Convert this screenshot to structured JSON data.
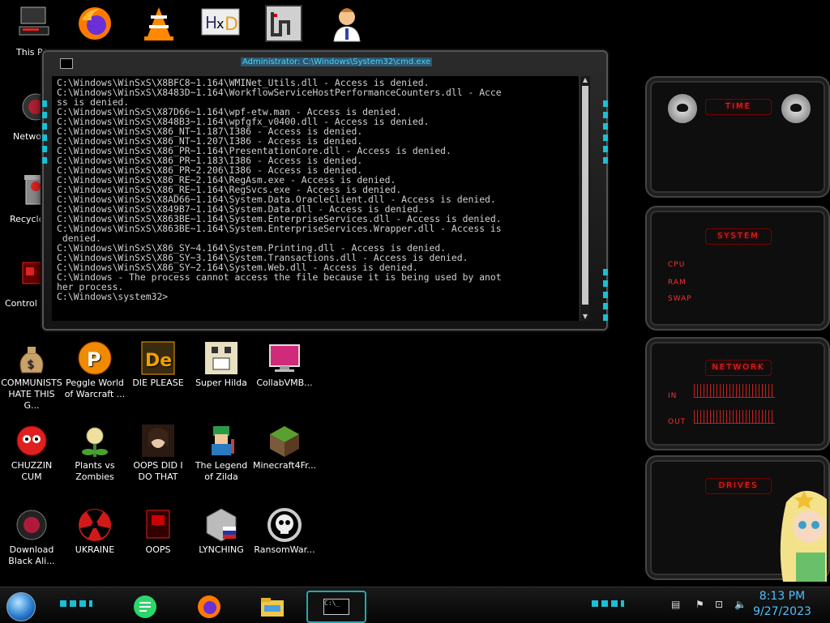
{
  "desktop": {
    "left_icons": [
      {
        "label": "This PC"
      },
      {
        "label": "Netwo"
      },
      {
        "label": "Recycle"
      },
      {
        "label": "Control"
      }
    ],
    "icons": [
      {
        "label": "COMMUNISTS HATE THIS G..."
      },
      {
        "label": "Peggle World of Warcraft ..."
      },
      {
        "label": "DIE PLEASE"
      },
      {
        "label": "Super Hilda"
      },
      {
        "label": "CollabVMB..."
      },
      {
        "label": "CHUZZIN CUM"
      },
      {
        "label": "Plants vs Zombies"
      },
      {
        "label": "OOPS DID I DO THAT"
      },
      {
        "label": "The Legend of Zilda"
      },
      {
        "label": "Minecraft4Fr..."
      },
      {
        "label": "Download Black Ali..."
      },
      {
        "label": "UKRAINE"
      },
      {
        "label": "OOPS"
      },
      {
        "label": "LYNCHING"
      },
      {
        "label": "RansomWar..."
      }
    ]
  },
  "console": {
    "title": "Administrator: C:\\Windows\\System32\\cmd.exe",
    "lines": [
      "C:\\Windows\\WinSxS\\X8BFC8~1.164\\WMINet_Utils.dll - Access is denied.",
      "C:\\Windows\\WinSxS\\X8483D~1.164\\WorkflowServiceHostPerformanceCounters.dll - Acce",
      "ss is denied.",
      "C:\\Windows\\WinSxS\\X87D66~1.164\\wpf-etw.man - Access is denied.",
      "C:\\Windows\\WinSxS\\X848B3~1.164\\wpfgfx_v0400.dll - Access is denied.",
      "C:\\Windows\\WinSxS\\X86_NT~1.187\\I386 - Access is denied.",
      "C:\\Windows\\WinSxS\\X86_NT~1.207\\I386 - Access is denied.",
      "C:\\Windows\\WinSxS\\X86_PR~1.164\\PresentationCore.dll - Access is denied.",
      "C:\\Windows\\WinSxS\\X86_PR~1.183\\I386 - Access is denied.",
      "C:\\Windows\\WinSxS\\X86_PR~2.206\\I386 - Access is denied.",
      "C:\\Windows\\WinSxS\\X86_RE~2.164\\RegAsm.exe - Access is denied.",
      "C:\\Windows\\WinSxS\\X86_RE~1.164\\RegSvcs.exe - Access is denied.",
      "C:\\Windows\\WinSxS\\X8AD66~1.164\\System.Data.OracleClient.dll - Access is denied.",
      "C:\\Windows\\WinSxS\\X849B7~1.164\\System.Data.dll - Access is denied.",
      "C:\\Windows\\WinSxS\\X863BE~1.164\\System.EnterpriseServices.dll - Access is denied.",
      "",
      "C:\\Windows\\WinSxS\\X863BE~1.164\\System.EnterpriseServices.Wrapper.dll - Access is",
      " denied.",
      "C:\\Windows\\WinSxS\\X86_SY~4.164\\System.Printing.dll - Access is denied.",
      "C:\\Windows\\WinSxS\\X86_SY~3.164\\System.Transactions.dll - Access is denied.",
      "C:\\Windows\\WinSxS\\X86_SY~2.164\\System.Web.dll - Access is denied.",
      "C:\\Windows - The process cannot access the file because it is being used by anot",
      "her process.",
      "",
      "C:\\Windows\\system32>"
    ]
  },
  "widgets": {
    "time_title": "TIME",
    "system_title": "SYSTEM",
    "system_labels": [
      "CPU",
      "RAM",
      "SWAP"
    ],
    "network_title": "NETWORK",
    "network_in": "IN",
    "network_out": "OUT",
    "drives_title": "DRIVES",
    "accent_color": "#ff2222",
    "cyan_color": "#19c0d6"
  },
  "taskbar": {
    "time": "8:13 PM",
    "date": "9/27/2023",
    "console_icon_text": "C:\\_"
  }
}
